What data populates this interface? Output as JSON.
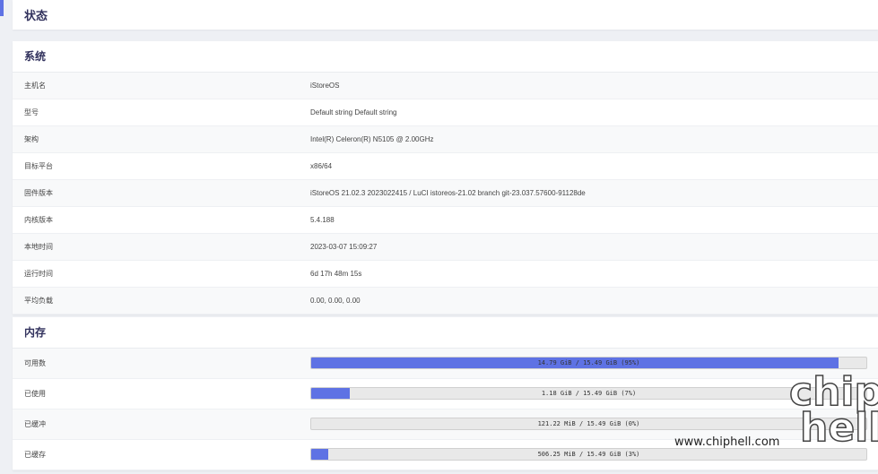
{
  "header": {
    "title": "状态"
  },
  "system": {
    "title": "系统",
    "rows": [
      {
        "k": "主机名",
        "v": "iStoreOS"
      },
      {
        "k": "型号",
        "v": "Default string Default string"
      },
      {
        "k": "架构",
        "v": "Intel(R) Celeron(R) N5105 @ 2.00GHz"
      },
      {
        "k": "目标平台",
        "v": "x86/64"
      },
      {
        "k": "固件版本",
        "v": "iStoreOS 21.02.3 2023022415 / LuCI istoreos-21.02 branch git-23.037.57600-91128de"
      },
      {
        "k": "内核版本",
        "v": "5.4.188"
      },
      {
        "k": "本地时间",
        "v": "2023-03-07 15:09:27"
      },
      {
        "k": "运行时间",
        "v": "6d 17h 48m 15s"
      },
      {
        "k": "平均负载",
        "v": "0.00, 0.00, 0.00"
      }
    ]
  },
  "memory": {
    "title": "内存",
    "rows": [
      {
        "k": "可用数",
        "text": "14.79 GiB / 15.49 GiB (95%)",
        "percent": 95
      },
      {
        "k": "已使用",
        "text": "1.18 GiB / 15.49 GiB (7%)",
        "percent": 7
      },
      {
        "k": "已缓冲",
        "text": "121.22 MiB / 15.49 GiB (0%)",
        "percent": 0
      },
      {
        "k": "已缓存",
        "text": "506.25 MiB / 15.49 GiB (3%)",
        "percent": 3
      }
    ]
  },
  "watermark": {
    "site": "www.chiphell.com",
    "logo_top": "chip",
    "logo_bottom": "hell"
  },
  "colors": {
    "accent": "#5e72e4"
  }
}
